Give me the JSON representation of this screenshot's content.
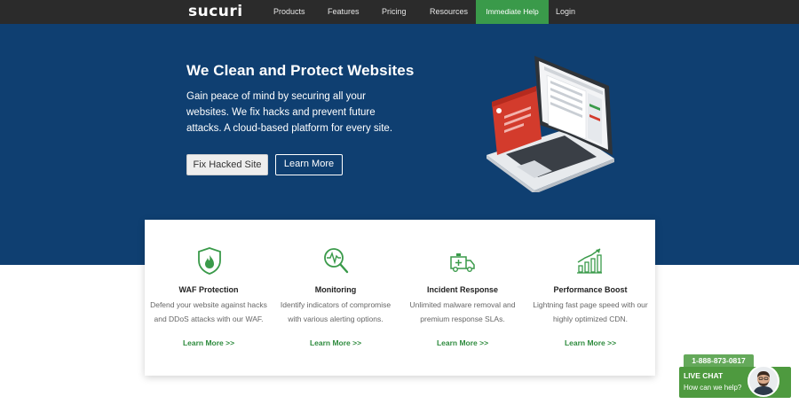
{
  "nav": {
    "logo": "sucuri",
    "links": [
      {
        "label": "Products"
      },
      {
        "label": "Features"
      },
      {
        "label": "Pricing"
      },
      {
        "label": "Resources"
      }
    ],
    "cta": "Immediate Help",
    "login": "Login"
  },
  "hero": {
    "title": "We Clean and Protect Websites",
    "description": "Gain peace of mind by securing all your websites. We fix hacks and prevent future attacks. A cloud-based platform for every site.",
    "primary_button": "Fix Hacked Site",
    "secondary_button": "Learn More"
  },
  "features": [
    {
      "icon": "shield-fire-icon",
      "title": "WAF Protection",
      "description": "Defend your website against hacks and DDoS attacks with our WAF.",
      "link": "Learn More >>"
    },
    {
      "icon": "magnifier-pulse-icon",
      "title": "Monitoring",
      "description": "Identify indicators of compromise with various alerting options.",
      "link": "Learn More >>"
    },
    {
      "icon": "ambulance-icon",
      "title": "Incident Response",
      "description": "Unlimited malware removal and premium response SLAs.",
      "link": "Learn More >>"
    },
    {
      "icon": "growth-chart-icon",
      "title": "Performance Boost",
      "description": "Lightning fast page speed with our highly optimized CDN.",
      "link": "Learn More >>"
    }
  ],
  "chat": {
    "phone": "1-888-873-0817",
    "title": "LIVE CHAT",
    "subtitle": "How can we help?"
  },
  "colors": {
    "nav_bg": "#2b2b2b",
    "hero_bg": "#0f3f71",
    "accent_green": "#3a9a4a",
    "link_green": "#2e8b3e"
  }
}
